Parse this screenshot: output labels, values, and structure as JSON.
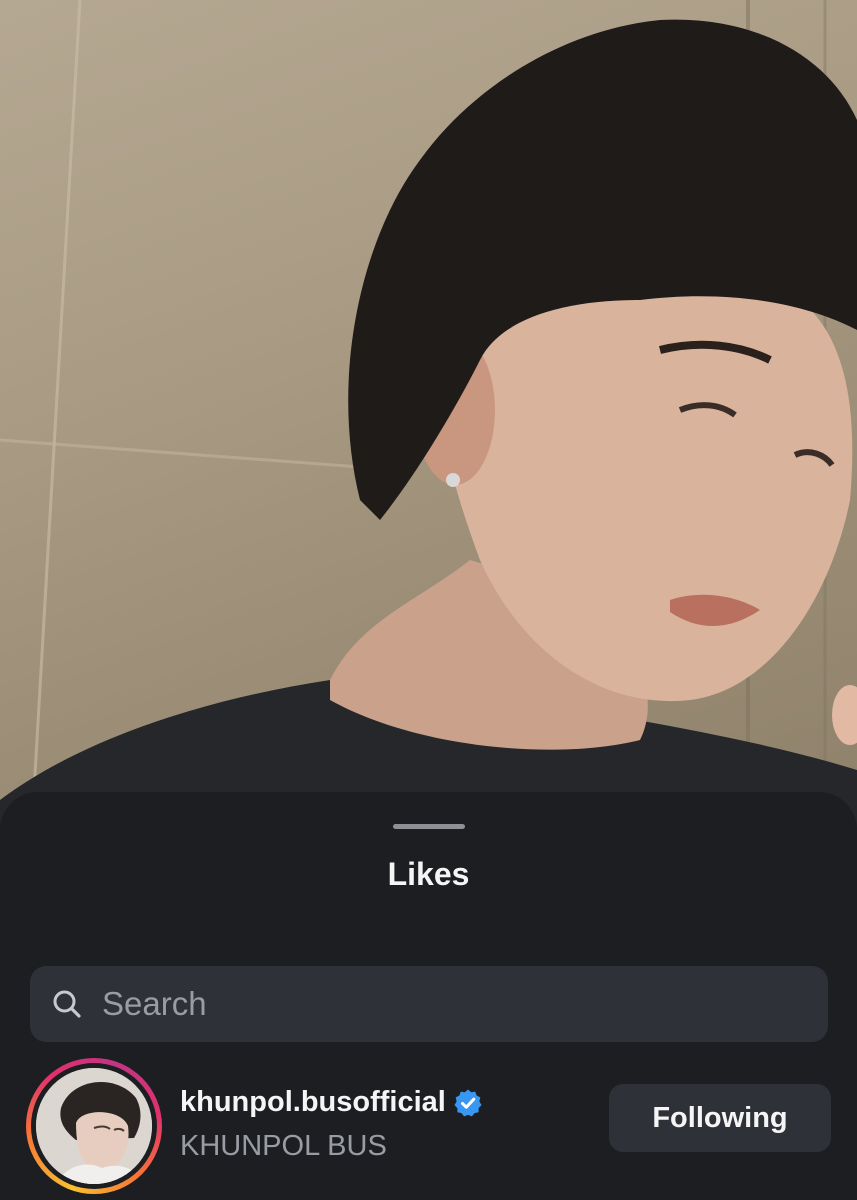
{
  "sheet": {
    "title": "Likes"
  },
  "search": {
    "placeholder": "Search",
    "value": ""
  },
  "likes": [
    {
      "username": "khunpol.busofficial",
      "full_name": "KHUNPOL BUS",
      "verified": true,
      "has_story_ring": true,
      "button_label": "Following"
    }
  ],
  "icons": {
    "search": "search-icon",
    "verified": "verified-badge-icon"
  },
  "colors": {
    "sheet_background": "#1c1e22",
    "search_background": "#2e3138",
    "verified_blue": "#3897f0"
  }
}
